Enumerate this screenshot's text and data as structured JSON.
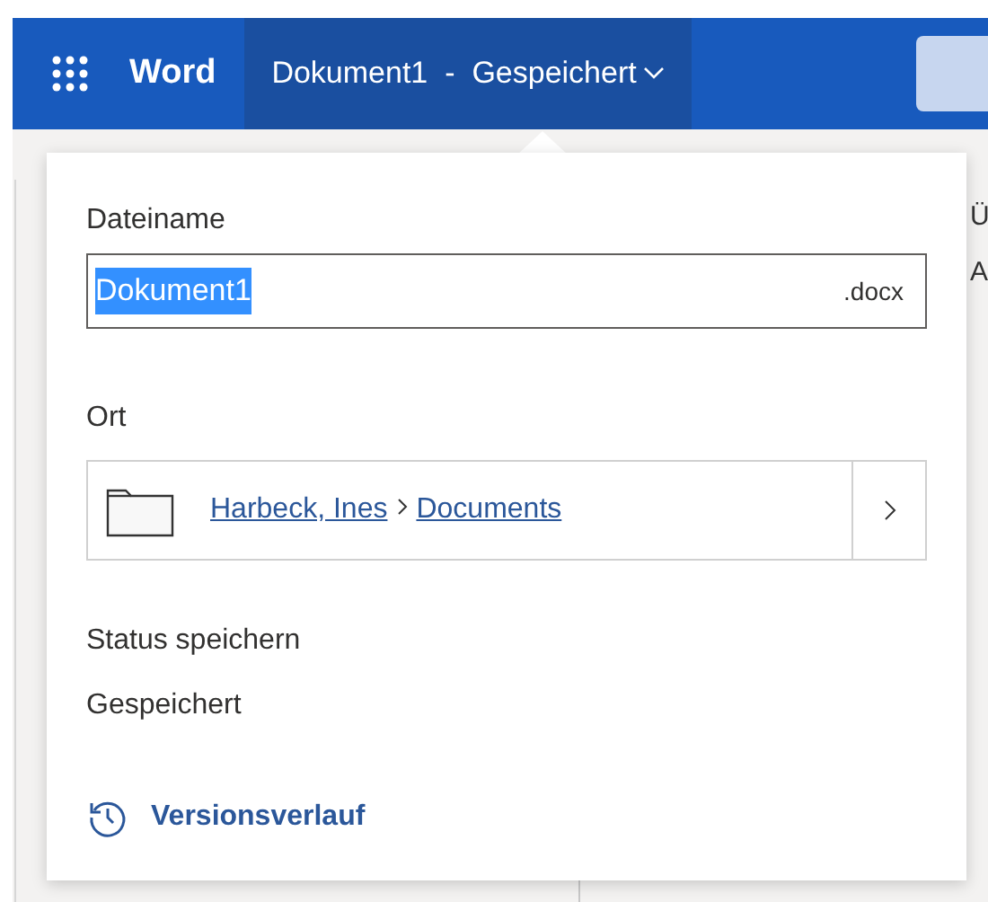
{
  "app_bar": {
    "app_name": "Word",
    "document_title": "Dokument1",
    "separator": "-",
    "save_status": "Gespeichert"
  },
  "background_fragments": [
    "Ü",
    "A"
  ],
  "panel": {
    "file_name_label": "Dateiname",
    "file_name_field": {
      "value": "Dokument1",
      "selected": true,
      "extension": ".docx"
    },
    "location_label": "Ort",
    "location_path": [
      {
        "label": "Harbeck, Ines"
      },
      {
        "label": "Documents"
      }
    ],
    "save_status_label": "Status speichern",
    "save_status_value": "Gespeichert",
    "version_history_link": "Versionsverlauf"
  }
}
